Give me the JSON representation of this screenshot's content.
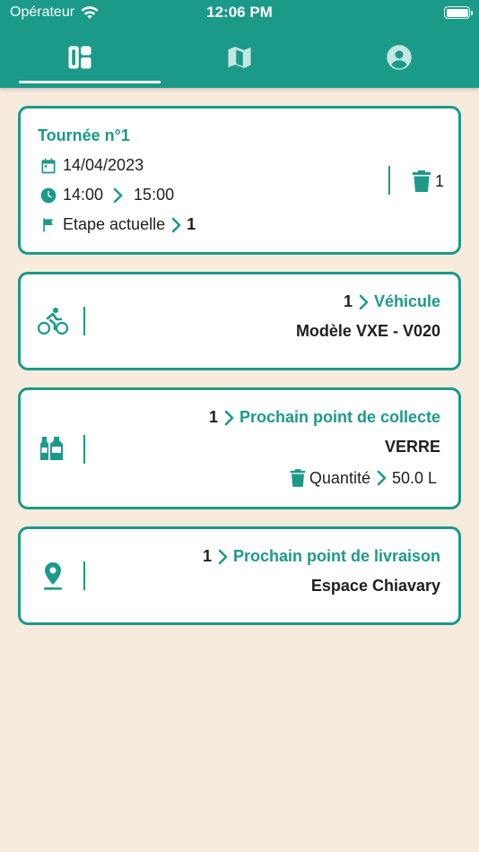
{
  "status_bar": {
    "carrier": "Opérateur",
    "time": "12:06 PM"
  },
  "colors": {
    "accent": "#1b9a89",
    "background": "#f7ebde",
    "card": "#ffffff",
    "text": "#1f1f1f"
  },
  "tabs": [
    {
      "icon": "dashboard-icon",
      "selected": true
    },
    {
      "icon": "map-icon",
      "selected": false
    },
    {
      "icon": "account-icon",
      "selected": false
    }
  ],
  "tour": {
    "title": "Tournée n°1",
    "date": "14/04/2023",
    "start_time": "14:00",
    "end_time": "15:00",
    "step_label": "Etape actuelle",
    "step_value": "1",
    "bin_count": "1"
  },
  "vehicle": {
    "count": "1",
    "label": "Véhicule",
    "model": "Modèle VXE - V020"
  },
  "collection": {
    "count": "1",
    "label": "Prochain point de collecte",
    "material": "VERRE",
    "quantity_label": "Quantité",
    "quantity_value": "50.0 L"
  },
  "delivery": {
    "count": "1",
    "label": "Prochain point de livraison",
    "place": "Espace Chiavary"
  }
}
